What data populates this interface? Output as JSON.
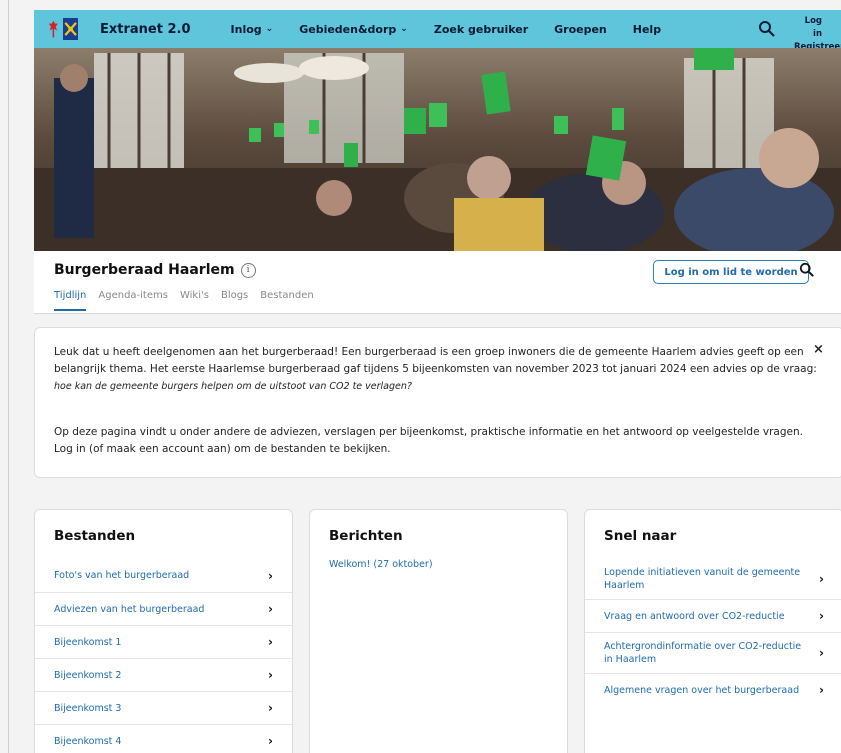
{
  "nav": {
    "brand": "Extranet 2.0",
    "items": [
      {
        "label": "Inlog",
        "has_dropdown": true
      },
      {
        "label": "Gebieden&dorp",
        "has_dropdown": true
      },
      {
        "label": "Zoek gebruiker",
        "has_dropdown": false
      },
      {
        "label": "Groepen",
        "has_dropdown": false
      },
      {
        "label": "Help",
        "has_dropdown": false
      }
    ],
    "login_label": "Log in",
    "register_label": "Registreer",
    "icons": {
      "search": "search-icon",
      "dropdown": "chevron-down-icon"
    }
  },
  "group": {
    "title": "Burgerberaad Haarlem",
    "join_button": "Log in om lid te worden",
    "tabs": [
      "Tijdlijn",
      "Agenda-items",
      "Wiki's",
      "Blogs",
      "Bestanden"
    ],
    "active_tab": "Tijdlijn"
  },
  "intro": {
    "p1": "Leuk dat u heeft deelgenomen aan het burgerberaad! Een burgerberaad is een groep inwoners die de gemeente Haarlem advies geeft op een belangrijk thema. Het eerste Haarlemse burgerberaad gaf tijdens 5 bijeenkomsten van november 2023 tot januari 2024 een advies op de vraag:",
    "question": "hoe kan de gemeente burgers helpen om de uitstoot van CO2 te verlagen?",
    "p2": "Op deze pagina vindt u onder andere de adviezen, verslagen per bijeenkomst, praktische informatie en het antwoord op veelgestelde vragen. Log in (of maak een account aan) om de bestanden te bekijken.",
    "close_label": "×"
  },
  "bestanden": {
    "title": "Bestanden",
    "items": [
      "Foto's van het burgerberaad",
      "Adviezen van het burgerberaad",
      "Bijeenkomst 1",
      "Bijeenkomst 2",
      "Bijeenkomst 3",
      "Bijeenkomst 4"
    ]
  },
  "berichten": {
    "title": "Berichten",
    "items": [
      "Welkom! (27 oktober)"
    ]
  },
  "snel_naar": {
    "title": "Snel naar",
    "items": [
      "Lopende initiatieven vanuit de gemeente Haarlem",
      "Vraag en antwoord over CO2-reductie",
      "Achtergrondinformatie over CO2-reductie in Haarlem",
      "Algemene vragen over het burgerberaad"
    ]
  },
  "colors": {
    "nav_bg": "#5ec5da",
    "link": "#1e6bb0",
    "logo_blue": "#1b3d91",
    "logo_red": "#d3202f"
  }
}
